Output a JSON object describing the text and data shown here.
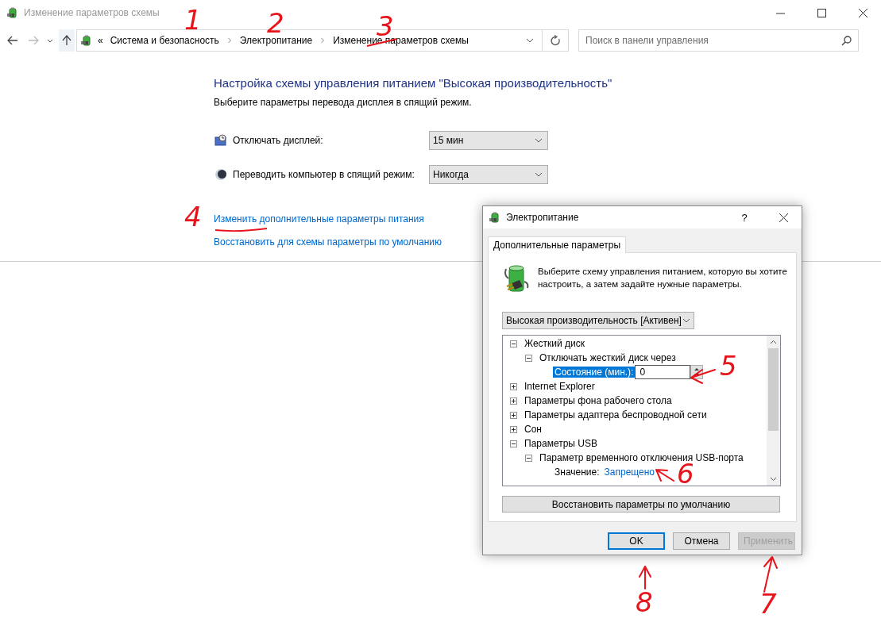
{
  "window": {
    "title": "Изменение параметров схемы"
  },
  "address_bar": {
    "overflow": "«",
    "breadcrumbs": [
      {
        "label": "Система и безопасность"
      },
      {
        "label": "Электропитание"
      },
      {
        "label": "Изменение параметров схемы"
      }
    ]
  },
  "search": {
    "placeholder": "Поиск в панели управления"
  },
  "heading": "Настройка схемы управления питанием \"Высокая производительность\"",
  "subtitle": "Выберите параметры перевода дисплея в спящий режим.",
  "settings": [
    {
      "kind": "display",
      "label": "Отключать дисплей:",
      "value": "15 мин"
    },
    {
      "kind": "sleep",
      "label": "Переводить компьютер в спящий режим:",
      "value": "Никогда"
    }
  ],
  "links": [
    "Изменить дополнительные параметры питания",
    "Восстановить для схемы параметры по умолчанию"
  ],
  "dialog": {
    "title": "Электропитание",
    "help": "?",
    "tabs": [
      {
        "label": "Дополнительные параметры",
        "selected": true
      }
    ],
    "description": "Выберите схему управления питанием, которую вы хотите настроить, а затем задайте нужные параметры.",
    "plan": "Высокая производительность [Активен]",
    "tree": [
      {
        "label": "Жесткий диск",
        "expanded": true,
        "selected": false,
        "children": [
          {
            "label": "Отключать жесткий диск через",
            "expanded": true,
            "selected": false,
            "children": [
              {
                "kind": "spin",
                "label": "Состояние (мин.):",
                "value": "0",
                "selected": true
              }
            ]
          }
        ]
      },
      {
        "label": "Internet Explorer",
        "expanded": false,
        "selected": false
      },
      {
        "label": "Параметры фона рабочего стола",
        "expanded": false,
        "selected": false
      },
      {
        "label": "Параметры адаптера беспроводной сети",
        "expanded": false,
        "selected": false
      },
      {
        "label": "Сон",
        "expanded": false,
        "selected": false
      },
      {
        "label": "Параметры USB",
        "expanded": true,
        "selected": false,
        "children": [
          {
            "label": "Параметр временного отключения USB-порта",
            "expanded": true,
            "selected": false,
            "children": [
              {
                "kind": "value",
                "label": "Значение:",
                "value": "Запрещено",
                "selected": false
              }
            ]
          }
        ]
      }
    ],
    "restore_button": "Восстановить параметры по умолчанию",
    "buttons": [
      {
        "label": "OK",
        "default": true,
        "disabled": false
      },
      {
        "label": "Отмена",
        "default": false,
        "disabled": false
      },
      {
        "label": "Применить",
        "default": false,
        "disabled": true
      }
    ]
  },
  "annotations": [
    {
      "label": "1",
      "kind": "number"
    },
    {
      "label": "2",
      "kind": "number"
    },
    {
      "label": "3",
      "kind": "strike"
    },
    {
      "label": "4",
      "kind": "underline"
    },
    {
      "label": "5",
      "kind": "arrow"
    },
    {
      "label": "6",
      "kind": "arrow"
    },
    {
      "label": "8",
      "kind": "arrow"
    },
    {
      "label": "7",
      "kind": "arrow"
    }
  ]
}
